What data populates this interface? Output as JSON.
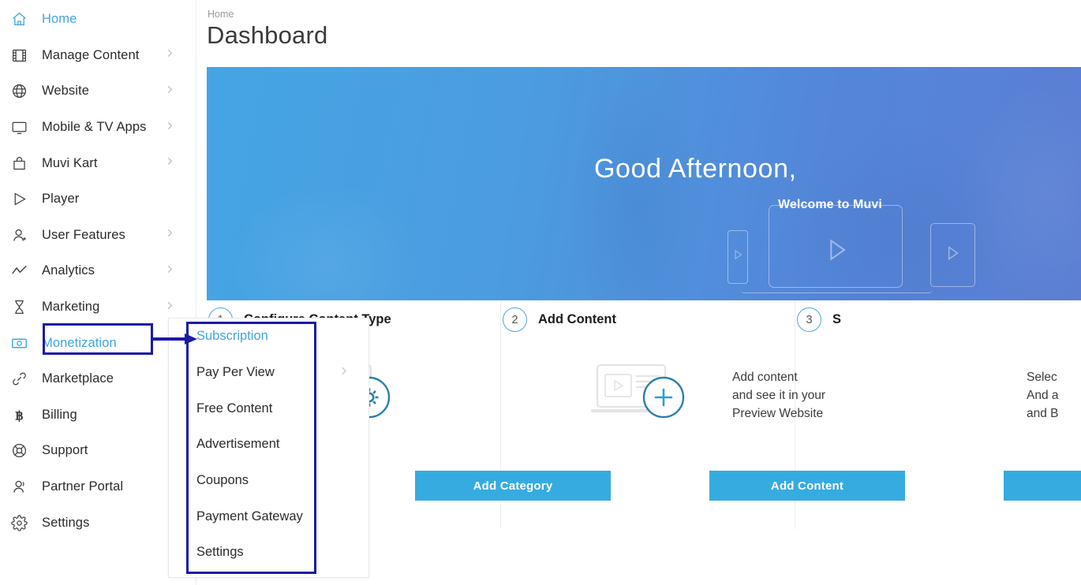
{
  "sidebar": {
    "items": [
      {
        "label": "Home",
        "icon": "home-icon",
        "chevron": false,
        "active": true
      },
      {
        "label": "Manage Content",
        "icon": "film-icon",
        "chevron": true,
        "active": false
      },
      {
        "label": "Website",
        "icon": "globe-icon",
        "chevron": true,
        "active": false
      },
      {
        "label": "Mobile & TV Apps",
        "icon": "monitor-icon",
        "chevron": true,
        "active": false
      },
      {
        "label": "Muvi Kart",
        "icon": "bag-icon",
        "chevron": true,
        "active": false
      },
      {
        "label": "Player",
        "icon": "play-icon",
        "chevron": false,
        "active": false
      },
      {
        "label": "User Features",
        "icon": "user-add-icon",
        "chevron": true,
        "active": false
      },
      {
        "label": "Analytics",
        "icon": "trend-line-icon",
        "chevron": true,
        "active": false
      },
      {
        "label": "Marketing",
        "icon": "hourglass-icon",
        "chevron": true,
        "active": false
      },
      {
        "label": "Monetization",
        "icon": "banknote-icon",
        "chevron": false,
        "active": true
      },
      {
        "label": "Marketplace",
        "icon": "link-icon",
        "chevron": false,
        "active": false
      },
      {
        "label": "Billing",
        "icon": "bitcoin-icon",
        "chevron": false,
        "active": false
      },
      {
        "label": "Support",
        "icon": "lifebuoy-icon",
        "chevron": false,
        "active": false
      },
      {
        "label": "Partner Portal",
        "icon": "user-group-icon",
        "chevron": false,
        "active": false
      },
      {
        "label": "Settings",
        "icon": "gear-icon",
        "chevron": false,
        "active": false
      }
    ]
  },
  "header": {
    "breadcrumb": "Home",
    "title": "Dashboard"
  },
  "banner": {
    "greeting": "Good Afternoon,",
    "welcome": "Welcome to Muvi"
  },
  "steps": [
    {
      "number": "1",
      "title": "Configure Content Type",
      "description": "",
      "button": "Add Category",
      "illustration": "laptop-gear-illustration"
    },
    {
      "number": "2",
      "title": "Add Content",
      "description": "Add content\nand see it in your\nPreview Website",
      "desc_lines": [
        "Add content",
        "and see it in your",
        "Preview Website"
      ],
      "button": "Add Content",
      "illustration": "laptop-plus-illustration"
    },
    {
      "number": "3",
      "title": "S",
      "description": "",
      "desc_lines": [
        "Selec",
        "And a",
        "and B"
      ],
      "button": "",
      "illustration": ""
    }
  ],
  "flyout": {
    "items": [
      {
        "label": "Subscription",
        "chevron": false,
        "active": true
      },
      {
        "label": "Pay Per View",
        "chevron": true,
        "active": false
      },
      {
        "label": "Free Content",
        "chevron": false,
        "active": false
      },
      {
        "label": "Advertisement",
        "chevron": false,
        "active": false
      },
      {
        "label": "Coupons",
        "chevron": false,
        "active": false
      },
      {
        "label": "Payment Gateway",
        "chevron": false,
        "active": false
      },
      {
        "label": "Settings",
        "chevron": false,
        "active": false
      }
    ]
  },
  "annotations": {
    "highlight_color": "#1a1aa8",
    "accent_color": "#42A5DD",
    "button_color": "#36ABE0"
  }
}
